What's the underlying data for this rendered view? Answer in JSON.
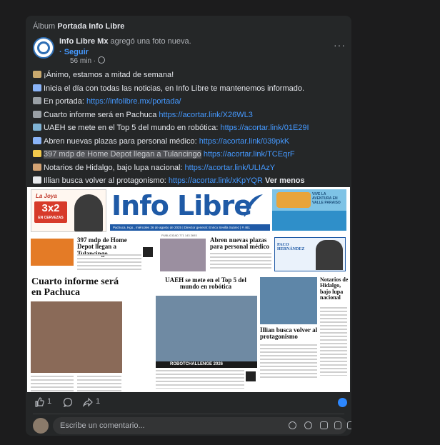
{
  "album": {
    "prefix": "Álbum",
    "name": "Portada Info Libre"
  },
  "post": {
    "author": "Info Libre Mx",
    "action": "agregó una foto nueva.",
    "follow_label": "· Seguir",
    "time": "56 min · ",
    "menu": "···"
  },
  "lines": [
    {
      "icon": "megaphone-icon",
      "color": "#c9a96e",
      "text": "¡Ánimo, estamos a mitad de semana!",
      "link": ""
    },
    {
      "icon": "pen-icon",
      "color": "#8ab4f8",
      "text": "Inicia el día con todas las noticias, en Info Libre te mantenemos informado.",
      "link": ""
    },
    {
      "icon": "newspaper-icon",
      "color": "#9aa0a6",
      "text": "En portada: ",
      "link": "https://infolibre.mx/portada/"
    },
    {
      "icon": "microphone-icon",
      "color": "#9aa0a6",
      "text": "Cuarto informe será en Pachuca ",
      "link": "https://acortar.link/X26WL3"
    },
    {
      "icon": "school-icon",
      "color": "#7fb3d5",
      "text": "UAEH se mete en el Top 5 del mundo en robótica: ",
      "link": "https://acortar.link/01E29I"
    },
    {
      "icon": "hospital-icon",
      "color": "#8ab4f8",
      "text": "Abren nuevas plazas para personal médico: ",
      "link": "https://acortar.link/039pkK"
    },
    {
      "icon": "sparkles-icon",
      "color": "#f2c94c",
      "text": "397 mdp de Home Depot llegan a Tulancingo",
      "link": "https://acortar.link/TCEqrF",
      "highlight": true
    },
    {
      "icon": "scroll-icon",
      "color": "#d4a373",
      "text": "Notarios de Hidalgo, bajo lupa nacional: ",
      "link": "https://acortar.link/ULIAzY"
    },
    {
      "icon": "soccer-ball-icon",
      "color": "#e8eaed",
      "text": "Illian busca volver al protagonismo: ",
      "link": "https://acortar.link/xKpYQR",
      "more": "Ver menos"
    }
  ],
  "newspaper": {
    "logo": "Info Libre",
    "dateline": "Pachuca, Hgo., miércoles 26 de agosto de 2025 | Director general: Enrico Sevilla Suárez | # 461",
    "ad_left_brand": "La Joya",
    "ad_left_promo": "3x2",
    "ad_left_small": "EN CERVEZAS",
    "ad_right_text": "VIVE LA AVENTURA EN VALLE PARAISO",
    "phone": "PUBLICIDAD 771 143 2693",
    "h1": "397 mdp de Home Depot llegan a Tulancingo",
    "h2": "Abren nuevas plazas para personal médico",
    "h3": "Cuarto informe será en Pachuca",
    "h4": "UAEH se mete en el Top 5 del mundo en robótica",
    "h5": "Illian busca volver al protagonismo",
    "h6": "Notarios de Hidalgo, bajo lupa nacional",
    "columnist": "PACO HERNÁNDEZ",
    "robot_banner": "ROBOTCHALLENGE 2026"
  },
  "reactions": {
    "like_count": "1",
    "share_count": "1"
  },
  "comment": {
    "placeholder": "Escribe un comentario..."
  },
  "colors": {
    "link": "#4599ff",
    "card": "#252728",
    "brand_blue": "#1f5aa6"
  }
}
